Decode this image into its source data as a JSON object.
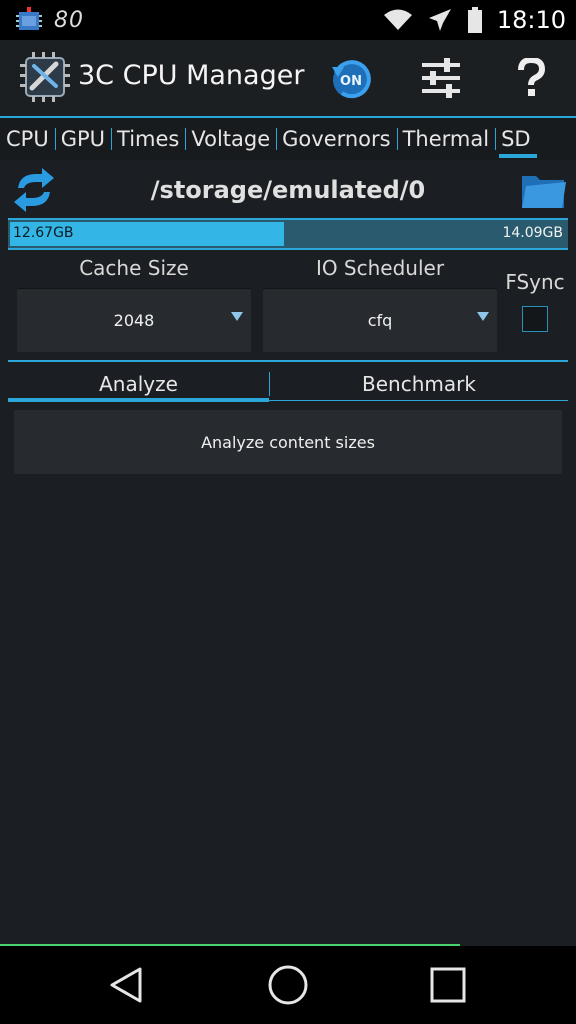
{
  "status_bar": {
    "left_number": "80",
    "time": "18:10",
    "icons": [
      "cpu-chip-notification-icon",
      "wifi-icon",
      "airplane-mode-icon",
      "battery-icon"
    ]
  },
  "action_bar": {
    "title": "3C CPU Manager",
    "on_label": "ON",
    "actions": [
      "power-on-toggle",
      "settings-sliders",
      "help"
    ]
  },
  "tabs": [
    {
      "label": "CPU"
    },
    {
      "label": "GPU"
    },
    {
      "label": "Times"
    },
    {
      "label": "Voltage"
    },
    {
      "label": "Governors"
    },
    {
      "label": "Thermal"
    },
    {
      "label": "SD",
      "active": true
    }
  ],
  "storage": {
    "path": "/storage/emulated/0",
    "used": "12.67GB",
    "total": "14.09GB",
    "used_fraction": 0.4895
  },
  "settings": {
    "cache_size_label": "Cache Size",
    "cache_size_value": "2048",
    "io_scheduler_label": "IO Scheduler",
    "io_scheduler_value": "cfq",
    "fsync_label": "FSync",
    "fsync_checked": false
  },
  "sub_tabs": {
    "analyze": "Analyze",
    "benchmark": "Benchmark",
    "active": "analyze"
  },
  "analyze_button": "Analyze content sizes",
  "colors": {
    "accent": "#33b5e5",
    "background": "#1b1f23",
    "button": "#272b30"
  }
}
